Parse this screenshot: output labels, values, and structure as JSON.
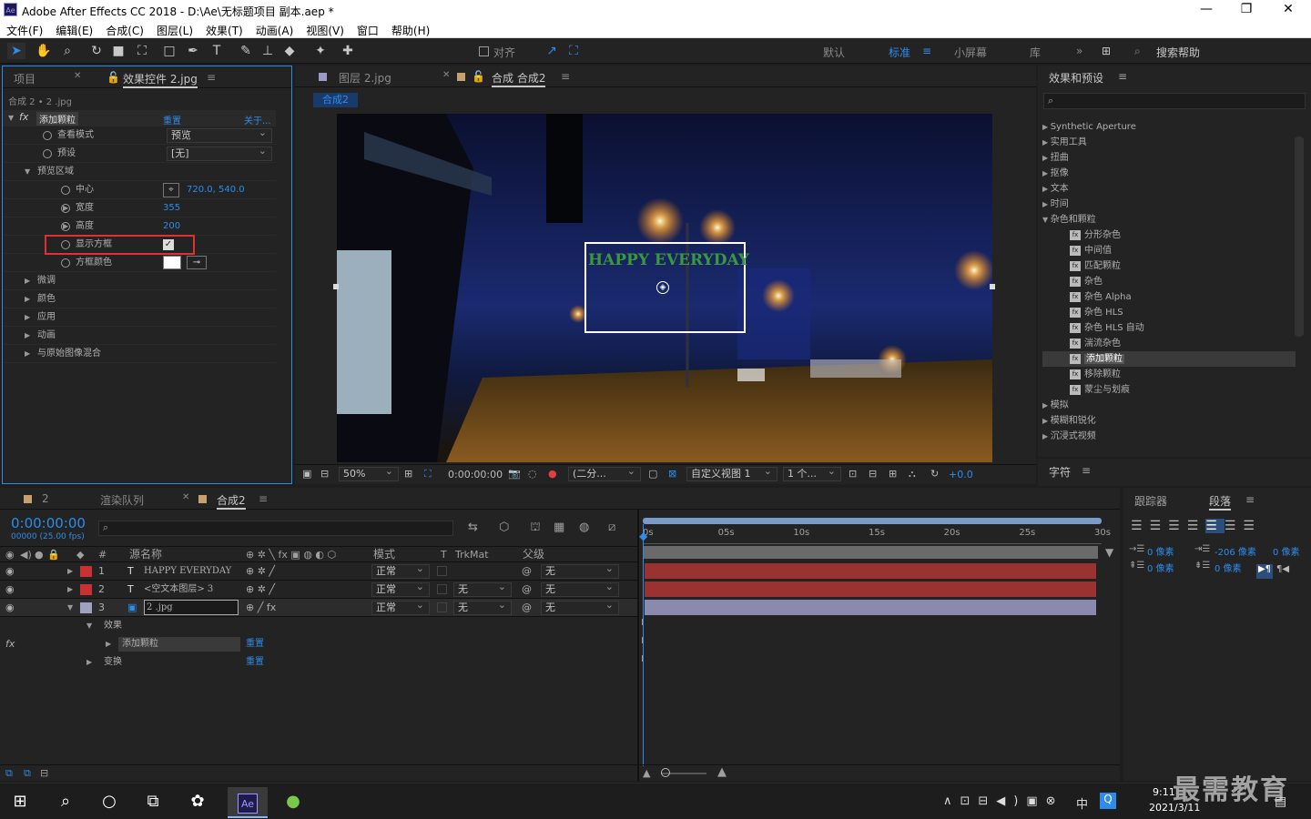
{
  "app": {
    "title": "Adobe After Effects CC 2018 - D:\\Ae\\无标题项目 副本.aep *",
    "logo": "Ae"
  },
  "menu": [
    "文件(F)",
    "编辑(E)",
    "合成(C)",
    "图层(L)",
    "效果(T)",
    "动画(A)",
    "视图(V)",
    "窗口",
    "帮助(H)"
  ],
  "toolbar": {
    "snap_label": "对齐",
    "workspaces": [
      "默认",
      "标准",
      "小屏幕",
      "库"
    ],
    "active_workspace": "标准",
    "search_placeholder": "搜索帮助"
  },
  "effects_panel": {
    "tabs": [
      "项目",
      "效果控件 2.jpg"
    ],
    "breadcrumb": "合成 2 • 2 .jpg",
    "effect_name": "添加颗粒",
    "reset": "重置",
    "about": "关于...",
    "rows": [
      {
        "label": "查看模式",
        "type": "dropdown",
        "value": "预览"
      },
      {
        "label": "预设",
        "type": "dropdown",
        "value": "[无]"
      },
      {
        "label": "预览区域",
        "type": "group"
      },
      {
        "label": "中心",
        "type": "point",
        "value": "720.0, 540.0"
      },
      {
        "label": "宽度",
        "type": "number",
        "value": "355"
      },
      {
        "label": "高度",
        "type": "number",
        "value": "200"
      },
      {
        "label": "显示方框",
        "type": "checkbox",
        "value": true
      },
      {
        "label": "方框颜色",
        "type": "color",
        "value": "#ffffff"
      },
      {
        "label": "微调",
        "type": "group"
      },
      {
        "label": "颜色",
        "type": "group"
      },
      {
        "label": "应用",
        "type": "group"
      },
      {
        "label": "动画",
        "type": "group"
      },
      {
        "label": "与原始图像混合",
        "type": "group"
      }
    ]
  },
  "viewer": {
    "tabs": [
      "图层 2.jpg",
      "合成 合成2"
    ],
    "comp_tab": "合成2",
    "overlay_text": "HAPPY EVERYDAY",
    "zoom": "50%",
    "timecode": "0:00:00:00",
    "resolution": "(二分...",
    "view": "自定义视图 1",
    "views": "1 个...",
    "exposure": "+0.0"
  },
  "effects_presets": {
    "title": "效果和预设",
    "search_placeholder": "",
    "items": [
      {
        "label": "Synthetic Aperture",
        "level": 0
      },
      {
        "label": "实用工具",
        "level": 0
      },
      {
        "label": "扭曲",
        "level": 0
      },
      {
        "label": "抠像",
        "level": 0
      },
      {
        "label": "文本",
        "level": 0
      },
      {
        "label": "时间",
        "level": 0
      },
      {
        "label": "杂色和颗粒",
        "level": 0,
        "open": true
      },
      {
        "label": "分形杂色",
        "level": 1
      },
      {
        "label": "中间值",
        "level": 1
      },
      {
        "label": "匹配颗粒",
        "level": 1
      },
      {
        "label": "杂色",
        "level": 1
      },
      {
        "label": "杂色 Alpha",
        "level": 1
      },
      {
        "label": "杂色 HLS",
        "level": 1
      },
      {
        "label": "杂色 HLS 自动",
        "level": 1
      },
      {
        "label": "湍流杂色",
        "level": 1
      },
      {
        "label": "添加颗粒",
        "level": 1,
        "selected": true
      },
      {
        "label": "移除颗粒",
        "level": 1
      },
      {
        "label": "蒙尘与划痕",
        "level": 1
      },
      {
        "label": "模拟",
        "level": 0
      },
      {
        "label": "模糊和锐化",
        "level": 0
      },
      {
        "label": "沉浸式视频",
        "level": 0
      }
    ]
  },
  "character": {
    "title": "字符"
  },
  "timeline": {
    "tabs": [
      "2",
      "渲染队列",
      "合成2"
    ],
    "timecode": "0:00:00:00",
    "fps": "00000 (25.00 fps)",
    "columns": {
      "num": "#",
      "source": "源名称",
      "mode": "模式",
      "t": "T",
      "trkmat": "TrkMat",
      "parent": "父级"
    },
    "layers": [
      {
        "num": "1",
        "type": "T",
        "name": "HAPPY EVERYDAY",
        "mode": "正常",
        "trkmat": "",
        "parent": "无",
        "color": "#c83232"
      },
      {
        "num": "2",
        "type": "T",
        "name": "<空文本图层> 3",
        "mode": "正常",
        "trkmat": "无",
        "parent": "无",
        "color": "#c83232"
      },
      {
        "num": "3",
        "type": "img",
        "name": "2 .jpg",
        "mode": "正常",
        "trkmat": "无",
        "parent": "无",
        "color": "#a0a0c0"
      }
    ],
    "sub": {
      "effects": "效果",
      "effect_item": "添加颗粒",
      "reset": "重置",
      "transform": "变换",
      "reset2": "重置"
    },
    "ruler": [
      "0s",
      "05s",
      "10s",
      "15s",
      "20s",
      "25s",
      "30s"
    ]
  },
  "paragraph": {
    "tabs": [
      "跟踪器",
      "段落"
    ],
    "indent_left": "0 像素",
    "indent_first": "-206 像素",
    "indent_right": "0 像素",
    "space_before": "0 像素",
    "space_after": "0 像素"
  },
  "taskbar": {
    "time": "9:11",
    "date": "2021/3/11",
    "ime": "中",
    "watermark": "最需教育"
  }
}
